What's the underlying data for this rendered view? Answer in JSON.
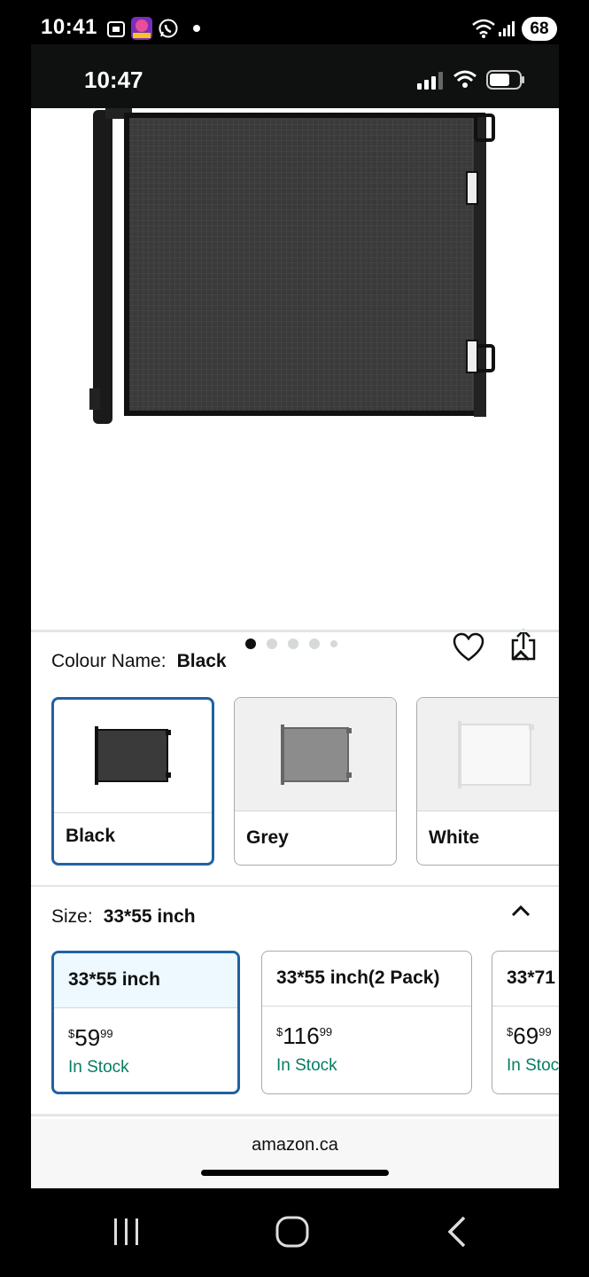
{
  "android_status": {
    "time": "10:41",
    "battery": "68",
    "icons": [
      "screenshot-icon",
      "slots-app-icon",
      "whatsapp-icon",
      "notification-dot-icon",
      "wifi-icon",
      "signal-icon"
    ]
  },
  "ios_status": {
    "time": "10:47",
    "icons": [
      "cellular-signal-icon",
      "wifi-icon",
      "battery-icon"
    ]
  },
  "gallery": {
    "image_count": 5,
    "active_index": 0,
    "actions": [
      "heart-icon",
      "share-icon"
    ]
  },
  "colour": {
    "label": "Colour Name:",
    "selected": "Black",
    "options": [
      {
        "label": "Black",
        "swatch": "#3a3a3a"
      },
      {
        "label": "Grey",
        "swatch": "#8c8c8c"
      },
      {
        "label": "White",
        "swatch": "#f2f2f2"
      }
    ]
  },
  "size": {
    "label": "Size:",
    "selected": "33*55 inch",
    "options": [
      {
        "label": "33*55 inch",
        "currency": "$",
        "whole": "59",
        "fraction": "99",
        "stock": "In Stock"
      },
      {
        "label": "33*55 inch(2 Pack)",
        "currency": "$",
        "whole": "116",
        "fraction": "99",
        "stock": "In Stock"
      },
      {
        "label": "33*71",
        "currency": "$",
        "whole": "69",
        "fraction": "99",
        "stock": "In Stoc"
      }
    ]
  },
  "browser": {
    "url": "amazon.ca"
  },
  "colors": {
    "selected_border": "#2162a1",
    "in_stock": "#067d62",
    "status_bar_bg": "#0f1111"
  },
  "android_nav": [
    "recents-icon",
    "home-icon",
    "back-icon"
  ]
}
